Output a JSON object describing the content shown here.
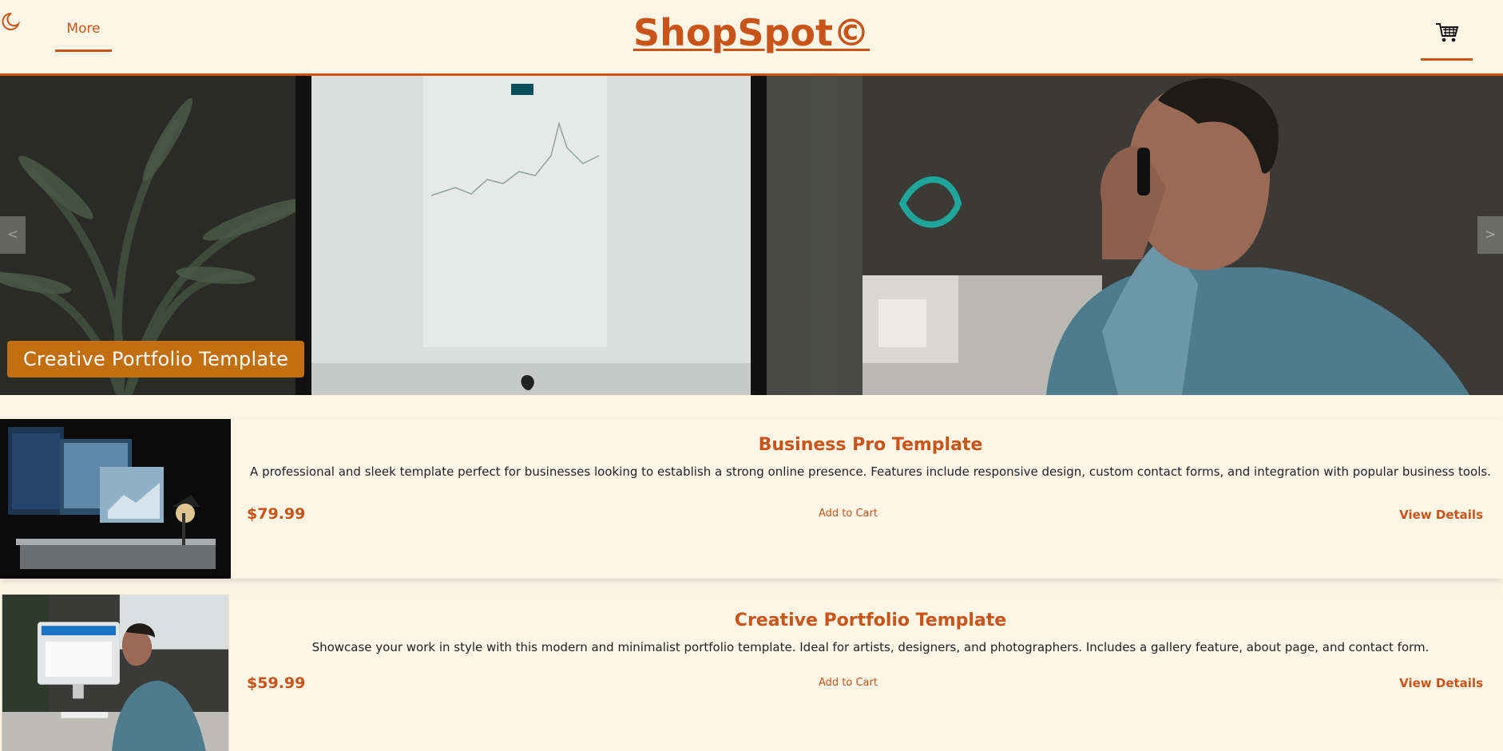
{
  "header": {
    "theme_toggle_icon": "moon-icon",
    "more_label": "More",
    "brand": "ShopSpot©",
    "cart_icon": "shopping-cart-icon"
  },
  "hero": {
    "caption": "Creative Portfolio Template",
    "prev_label": "<",
    "next_label": ">"
  },
  "products": [
    {
      "title": "Business Pro Template",
      "description": "A professional and sleek template perfect for businesses looking to establish a strong online presence. Features include responsive design, custom contact forms, and integration with popular business tools.",
      "price": "$79.99",
      "add_to_cart_label": "Add to Cart",
      "view_details_label": "View Details"
    },
    {
      "title": "Creative Portfolio Template",
      "description": "Showcase your work in style with this modern and minimalist portfolio template. Ideal for artists, designers, and photographers. Includes a gallery feature, about page, and contact form.",
      "price": "$59.99",
      "add_to_cart_label": "Add to Cart",
      "view_details_label": "View Details"
    }
  ],
  "colors": {
    "accent": "#c8541a",
    "background": "#fdf6e6",
    "caption_bg": "#c26f12"
  }
}
